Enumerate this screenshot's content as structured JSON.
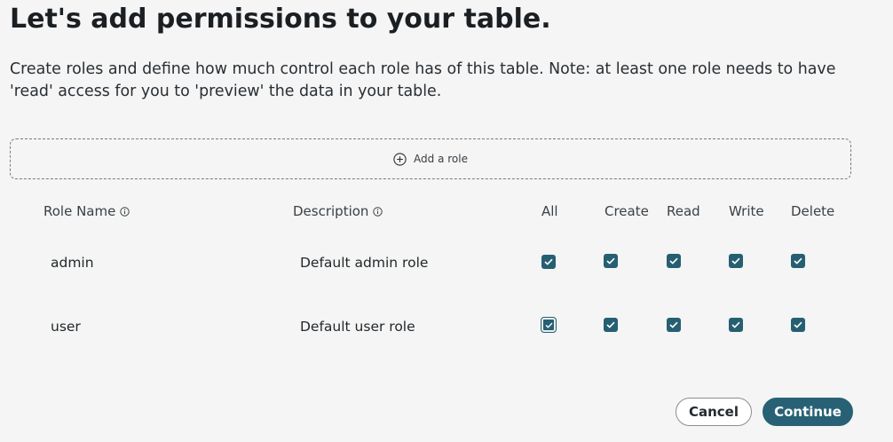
{
  "title": "Let's add permissions to your table.",
  "subtitle": "Create roles and define how much control each role has of this table. Note: at least one role needs to have 'read' access for you to 'preview' the data in your table.",
  "add_role": {
    "label": "Add a role",
    "icon": "plus-circle-icon"
  },
  "table": {
    "headers": {
      "role_name": "Role Name",
      "description": "Description",
      "all": "All",
      "create": "Create",
      "read": "Read",
      "write": "Write",
      "delete": "Delete"
    },
    "rows": [
      {
        "role": "admin",
        "description": "Default admin role",
        "all": true,
        "create": true,
        "read": true,
        "write": true,
        "delete": true
      },
      {
        "role": "user",
        "description": "Default user role",
        "all": true,
        "create": true,
        "read": true,
        "write": true,
        "delete": true
      }
    ]
  },
  "buttons": {
    "cancel": "Cancel",
    "continue": "Continue"
  },
  "colors": {
    "accent": "#286175",
    "background": "#f4f5f4"
  }
}
